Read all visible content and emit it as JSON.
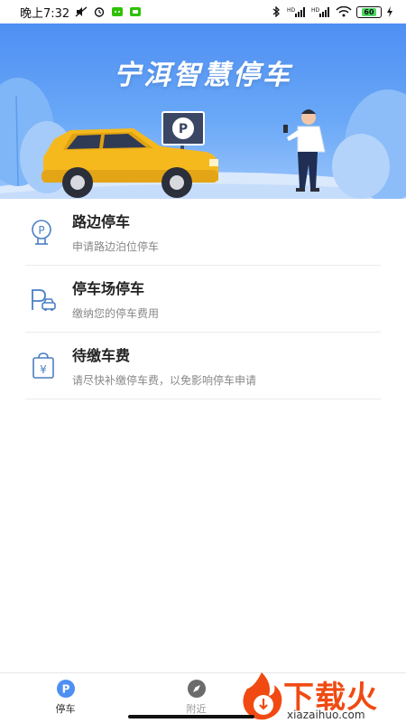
{
  "status_bar": {
    "time": "晚上7:32",
    "battery_level": "60",
    "network_labels": [
      "HD",
      "HD"
    ]
  },
  "banner": {
    "title": "宁洱智慧停车",
    "parking_sign": "P"
  },
  "menu": [
    {
      "title": "路边停车",
      "subtitle": "申请路边泊位停车",
      "icon": "roadside-parking-icon"
    },
    {
      "title": "停车场停车",
      "subtitle": "缴纳您的停车费用",
      "icon": "parking-lot-icon"
    },
    {
      "title": "待缴车费",
      "subtitle": "请尽快补缴停车费，以免影响停车申请",
      "icon": "pending-fee-icon"
    }
  ],
  "bottom_nav": {
    "tabs": [
      {
        "label": "停车",
        "icon": "parking-p-icon",
        "active": true
      },
      {
        "label": "附近",
        "icon": "compass-icon",
        "active": false
      }
    ]
  },
  "watermark": {
    "brand": "下载火",
    "domain": "xiazaihuo.com"
  },
  "colors": {
    "primary": "#4e8ff3",
    "icon_blue": "#4a7fc4",
    "watermark": "#f04a12",
    "car": "#f5b91e"
  }
}
